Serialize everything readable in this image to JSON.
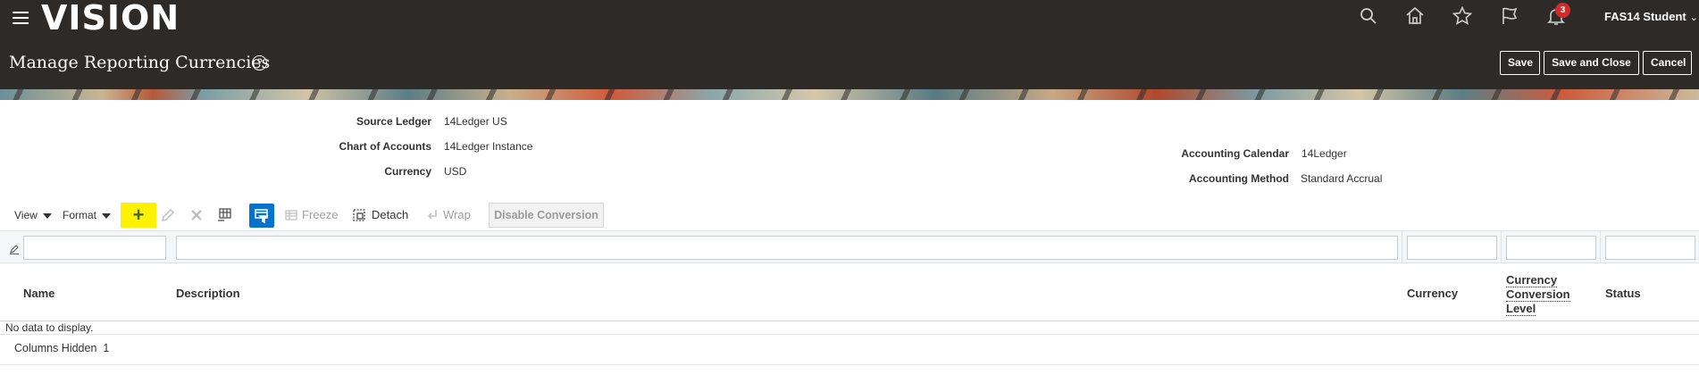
{
  "header": {
    "brand": "VISION",
    "user_name": "FAS14 Student",
    "notification_count": "3",
    "page_title": "Manage Reporting Currencies",
    "help_glyph": "?",
    "buttons": {
      "save": "Save",
      "save_close": "Save and Close",
      "cancel": "Cancel"
    },
    "icons": [
      "search-icon",
      "home-icon",
      "favorites-star-icon",
      "watchlist-flag-icon",
      "notifications-bell-icon"
    ]
  },
  "details": {
    "source_ledger": {
      "label": "Source Ledger",
      "value": "14Ledger US"
    },
    "chart_of_accounts": {
      "label": "Chart of Accounts",
      "value": "14Ledger Instance"
    },
    "currency": {
      "label": "Currency",
      "value": "USD"
    },
    "accounting_calendar": {
      "label": "Accounting Calendar",
      "value": "14Ledger"
    },
    "accounting_method": {
      "label": "Accounting Method",
      "value": "Standard Accrual"
    }
  },
  "toolbar": {
    "view": "View",
    "format": "Format",
    "add_glyph": "+",
    "freeze": "Freeze",
    "detach": "Detach",
    "wrap": "Wrap",
    "disable_conversion": "Disable Conversion"
  },
  "table": {
    "columns": {
      "name": "Name",
      "description": "Description",
      "currency": "Currency",
      "conversion_level_1": "Currency",
      "conversion_level_2": "Conversion",
      "conversion_level_3": "Level",
      "status": "Status"
    },
    "empty_message": "No data to display.",
    "columns_hidden_label": "Columns Hidden",
    "columns_hidden_count": "1"
  },
  "colors": {
    "header_bg": "#2e2a27",
    "highlight": "#fff200",
    "accent_blue": "#0572ce",
    "badge_red": "#d52a2a"
  }
}
